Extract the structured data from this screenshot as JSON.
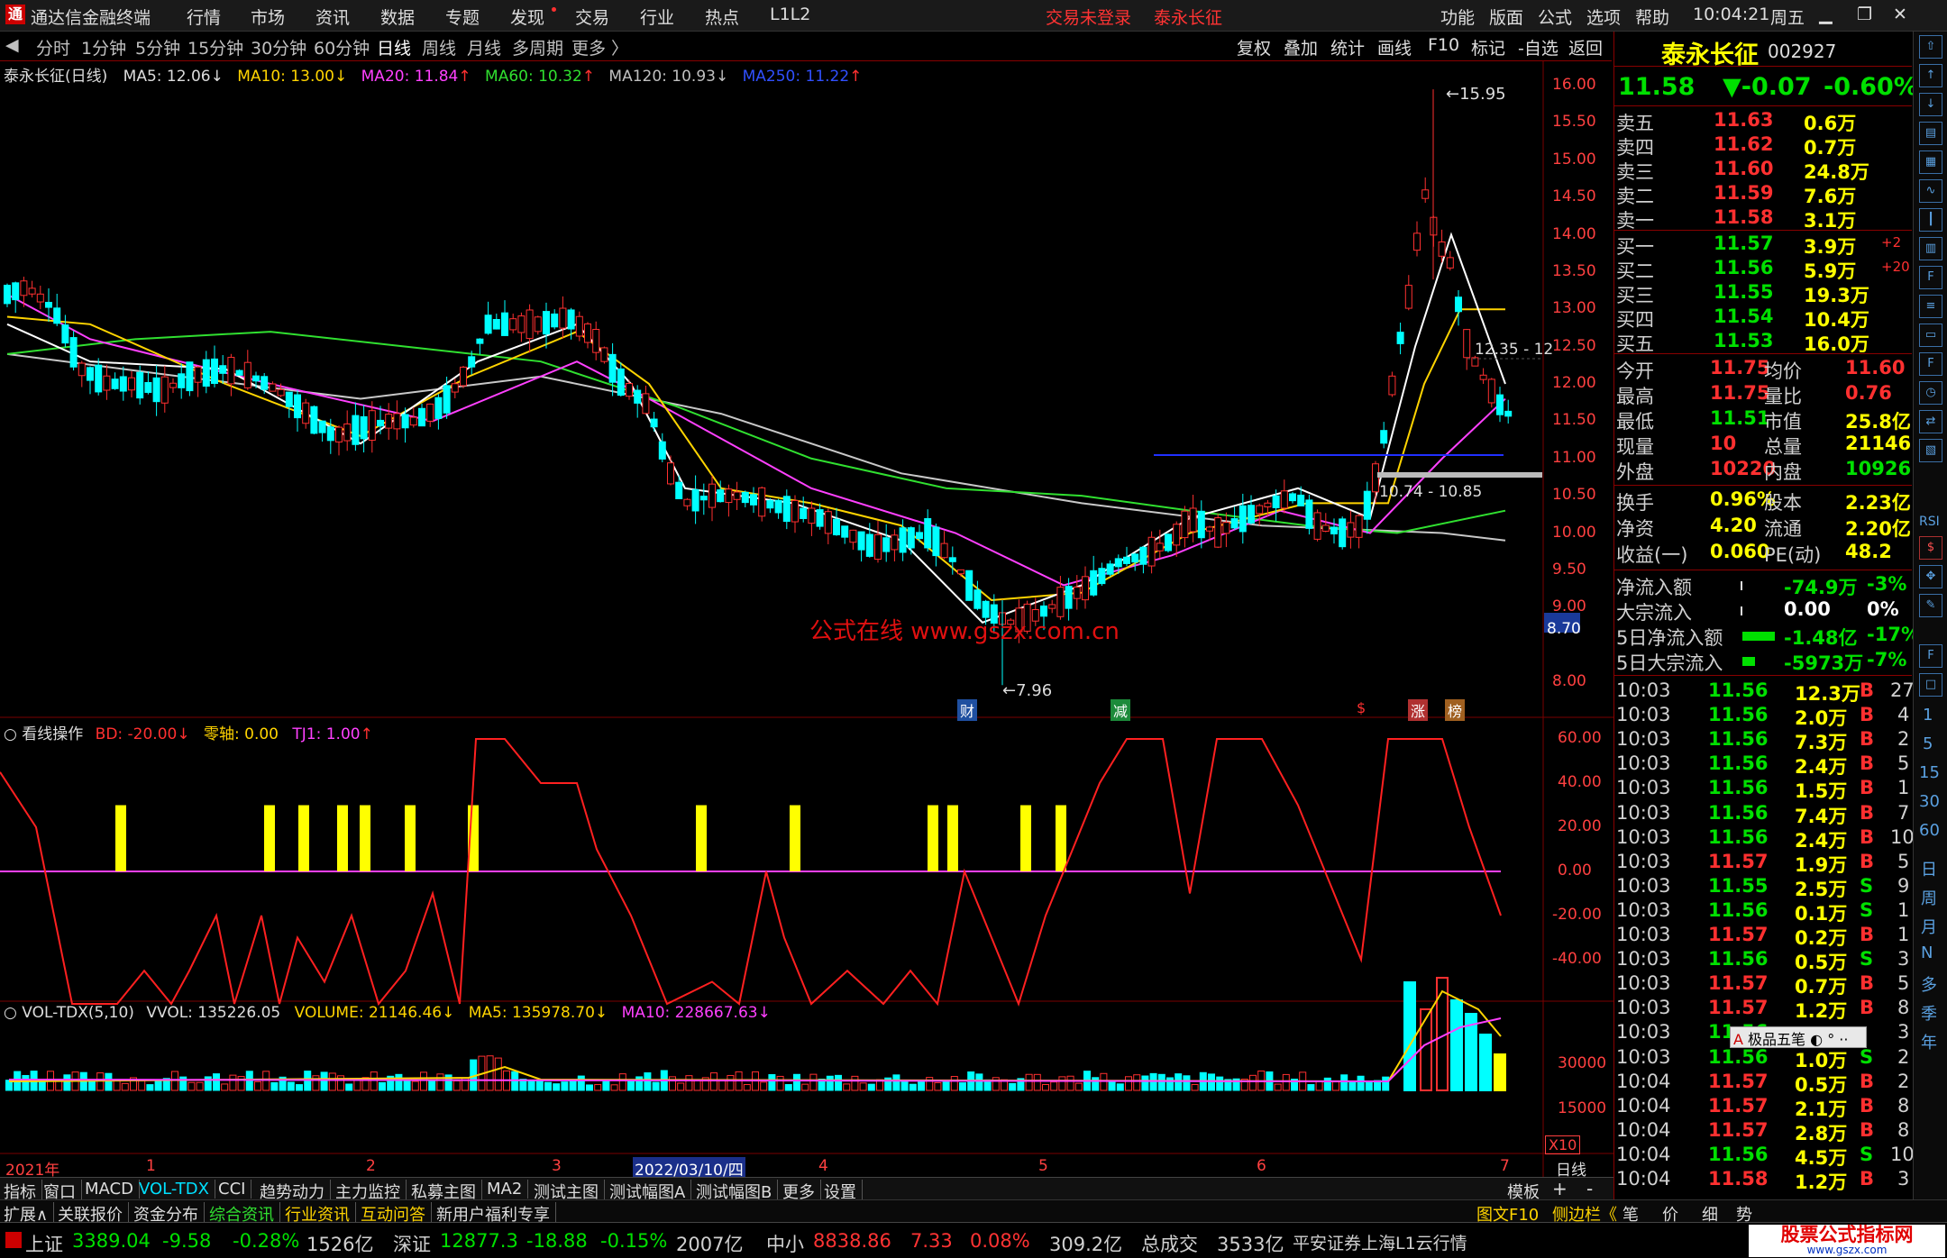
{
  "window": {
    "app_title": "通达信金融终端",
    "menus": [
      "行情",
      "市场",
      "资讯",
      "数据",
      "专题",
      "发现",
      "交易",
      "行业",
      "热点",
      "L1L2"
    ],
    "status_left": "交易未登录",
    "stock_short": "泰永长征",
    "menus_right": [
      "功能",
      "版面",
      "公式",
      "选项",
      "帮助"
    ],
    "time": "10:04:21",
    "weekday": "周五"
  },
  "periods": [
    "分时",
    "1分钟",
    "5分钟",
    "15分钟",
    "30分钟",
    "60分钟",
    "日线",
    "周线",
    "月线",
    "多周期",
    "更多 〉"
  ],
  "period_active": "日线",
  "chart_tools": [
    "复权",
    "叠加",
    "统计",
    "画线",
    "F10",
    "标记",
    "-自选",
    "返回"
  ],
  "main_legend": {
    "title": "泰永长征(日线)",
    "ma5": "MA5: 12.06",
    "ma10": "MA10: 13.00",
    "ma20": "MA20: 11.84",
    "ma60": "MA60: 10.32",
    "ma120": "MA120: 10.93",
    "ma250": "MA250: 11.22"
  },
  "main_axis": [
    "16.00",
    "15.50",
    "15.00",
    "14.50",
    "14.00",
    "13.50",
    "13.00",
    "12.50",
    "12.00",
    "11.50",
    "11.00",
    "10.50",
    "10.00",
    "9.50",
    "9.00",
    "8.70",
    "8.00"
  ],
  "main_marks": {
    "high": "15.95",
    "low": "7.96",
    "zone_high": "12.35 - 12",
    "zone_low": "10.74 - 10.85",
    "watermark": "公式在线  www.gszx.com.cn"
  },
  "event_marks": [
    "财",
    "减",
    "$",
    "涨",
    "榜"
  ],
  "ind_legend": {
    "name": "看线操作",
    "bd": "BD: -20.00",
    "zero": "零轴: 0.00",
    "tj1": "TJ1: 1.00"
  },
  "ind_axis": [
    "60.00",
    "40.00",
    "20.00",
    "0.00",
    "-20.00",
    "-40.00"
  ],
  "vol_legend": {
    "name": "VOL-TDX(5,10)",
    "vvol": "VVOL: 135226.05",
    "volume": "VOLUME: 21146.46",
    "ma5": "MA5: 135978.70",
    "ma10": "MA10: 228667.63"
  },
  "vol_axis": [
    "30000",
    "15000"
  ],
  "vol_unit": "X10",
  "time_axis": [
    "2021年",
    "1",
    "2",
    "3",
    "2022/03/10/四",
    "4",
    "5",
    "6",
    "7",
    "日线"
  ],
  "quote": {
    "name": "泰永长征",
    "code": "002927",
    "price": "11.58",
    "change": "▼-0.07",
    "pct": "-0.60%",
    "asks": [
      {
        "label": "卖五",
        "p": "11.63",
        "v": "0.6万",
        "d": ""
      },
      {
        "label": "卖四",
        "p": "11.62",
        "v": "0.7万",
        "d": ""
      },
      {
        "label": "卖三",
        "p": "11.60",
        "v": "24.8万",
        "d": ""
      },
      {
        "label": "卖二",
        "p": "11.59",
        "v": "7.6万",
        "d": ""
      },
      {
        "label": "卖一",
        "p": "11.58",
        "v": "3.1万",
        "d": ""
      }
    ],
    "bids": [
      {
        "label": "买一",
        "p": "11.57",
        "v": "3.9万",
        "d": "+2"
      },
      {
        "label": "买二",
        "p": "11.56",
        "v": "5.9万",
        "d": "+20"
      },
      {
        "label": "买三",
        "p": "11.55",
        "v": "19.3万",
        "d": ""
      },
      {
        "label": "买四",
        "p": "11.54",
        "v": "10.4万",
        "d": ""
      },
      {
        "label": "买五",
        "p": "11.53",
        "v": "16.0万",
        "d": ""
      }
    ],
    "stats1": [
      {
        "l1": "今开",
        "v1": "11.75",
        "l2": "均价",
        "v2": "11.60"
      },
      {
        "l1": "最高",
        "v1": "11.75",
        "l2": "量比",
        "v2": "0.76"
      },
      {
        "l1": "最低",
        "v1": "11.51",
        "l2": "市值",
        "v2": "25.8亿"
      },
      {
        "l1": "现量",
        "v1": "10",
        "l2": "总量",
        "v2": "21146"
      },
      {
        "l1": "外盘",
        "v1": "10220",
        "l2": "内盘",
        "v2": "10926"
      }
    ],
    "stats2": [
      {
        "l1": "换手",
        "v1": "0.96%",
        "l2": "股本",
        "v2": "2.23亿"
      },
      {
        "l1": "净资",
        "v1": "4.20",
        "l2": "流通",
        "v2": "2.20亿"
      },
      {
        "l1": "收益(一)",
        "v1": "0.060",
        "l2": "PE(动)",
        "v2": "48.2"
      }
    ],
    "flows": [
      {
        "label": "净流入额",
        "v": "-74.9万",
        "p": "-3%"
      },
      {
        "label": "大宗流入",
        "v": "0.00",
        "p": "0%"
      },
      {
        "label": "5日净流入额",
        "v": "-1.48亿",
        "p": "-17%"
      },
      {
        "label": "5日大宗流入",
        "v": "-5973万",
        "p": "-7%"
      }
    ],
    "ticks": [
      {
        "t": "10:03",
        "p": "11.56",
        "v": "12.3万",
        "s": "B",
        "n": "27"
      },
      {
        "t": "10:03",
        "p": "11.56",
        "v": "2.0万",
        "s": "B",
        "n": "4"
      },
      {
        "t": "10:03",
        "p": "11.56",
        "v": "7.3万",
        "s": "B",
        "n": "2"
      },
      {
        "t": "10:03",
        "p": "11.56",
        "v": "2.4万",
        "s": "B",
        "n": "5"
      },
      {
        "t": "10:03",
        "p": "11.56",
        "v": "1.5万",
        "s": "B",
        "n": "1"
      },
      {
        "t": "10:03",
        "p": "11.56",
        "v": "7.4万",
        "s": "B",
        "n": "7"
      },
      {
        "t": "10:03",
        "p": "11.56",
        "v": "2.4万",
        "s": "B",
        "n": "10"
      },
      {
        "t": "10:03",
        "p": "11.57",
        "v": "1.9万",
        "s": "B",
        "n": "5"
      },
      {
        "t": "10:03",
        "p": "11.55",
        "v": "2.5万",
        "s": "S",
        "n": "9"
      },
      {
        "t": "10:03",
        "p": "11.56",
        "v": "0.1万",
        "s": "S",
        "n": "1"
      },
      {
        "t": "10:03",
        "p": "11.57",
        "v": "0.2万",
        "s": "B",
        "n": "1"
      },
      {
        "t": "10:03",
        "p": "11.56",
        "v": "0.5万",
        "s": "S",
        "n": "3"
      },
      {
        "t": "10:03",
        "p": "11.57",
        "v": "0.7万",
        "s": "B",
        "n": "5"
      },
      {
        "t": "10:03",
        "p": "11.57",
        "v": "1.2万",
        "s": "B",
        "n": "8"
      },
      {
        "t": "10:03",
        "p": "11.56",
        "v": "",
        "s": "",
        "n": "3"
      },
      {
        "t": "10:03",
        "p": "11.56",
        "v": "1.0万",
        "s": "S",
        "n": "2"
      },
      {
        "t": "10:04",
        "p": "11.57",
        "v": "0.5万",
        "s": "B",
        "n": "2"
      },
      {
        "t": "10:04",
        "p": "11.57",
        "v": "2.1万",
        "s": "B",
        "n": "8"
      },
      {
        "t": "10:04",
        "p": "11.57",
        "v": "2.8万",
        "s": "B",
        "n": "8"
      },
      {
        "t": "10:04",
        "p": "11.56",
        "v": "4.5万",
        "s": "S",
        "n": "10"
      },
      {
        "t": "10:04",
        "p": "11.58",
        "v": "1.2万",
        "s": "B",
        "n": "3"
      }
    ],
    "popup": "极品五笔"
  },
  "strip_text": [
    "RSI",
    "1",
    "5",
    "15",
    "30",
    "60",
    "日",
    "周",
    "月",
    "N",
    "多",
    "季",
    "年"
  ],
  "tabs1": [
    "指标",
    "窗口",
    "MACD",
    "VOL-TDX",
    "CCI",
    "趋势动力",
    "主力监控",
    "私募主图",
    "MA2",
    "测试主图",
    "测试幅图A",
    "测试幅图B",
    "更多",
    "设置"
  ],
  "tabs1_right": [
    "模板",
    "+",
    "-"
  ],
  "tabs2": [
    "扩展∧",
    "关联报价",
    "资金分布",
    "综合资讯",
    "行业资讯",
    "互动问答",
    "新用户福利专享"
  ],
  "tabs2_right": [
    "图文F10",
    "侧边栏《",
    "笔",
    "价",
    "细",
    "势"
  ],
  "status": {
    "sh_label": "上证",
    "sh": "3389.04",
    "sh_chg": "-9.58",
    "sh_pct": "-0.28%",
    "sh_amt": "1526亿",
    "sz_label": "深证",
    "sz": "12877.3",
    "sz_chg": "-18.88",
    "sz_pct": "-0.15%",
    "sz_amt": "2007亿",
    "zx_label": "中小",
    "zx": "8838.86",
    "zx_chg": "7.33",
    "zx_pct": "0.08%",
    "zx_amt": "309.2亿",
    "total_label": "总成交",
    "total": "3533亿",
    "broker": "平安证券上海L1云行情",
    "brand": "股票公式指标网",
    "brand_url": "www.gszx.com"
  }
}
